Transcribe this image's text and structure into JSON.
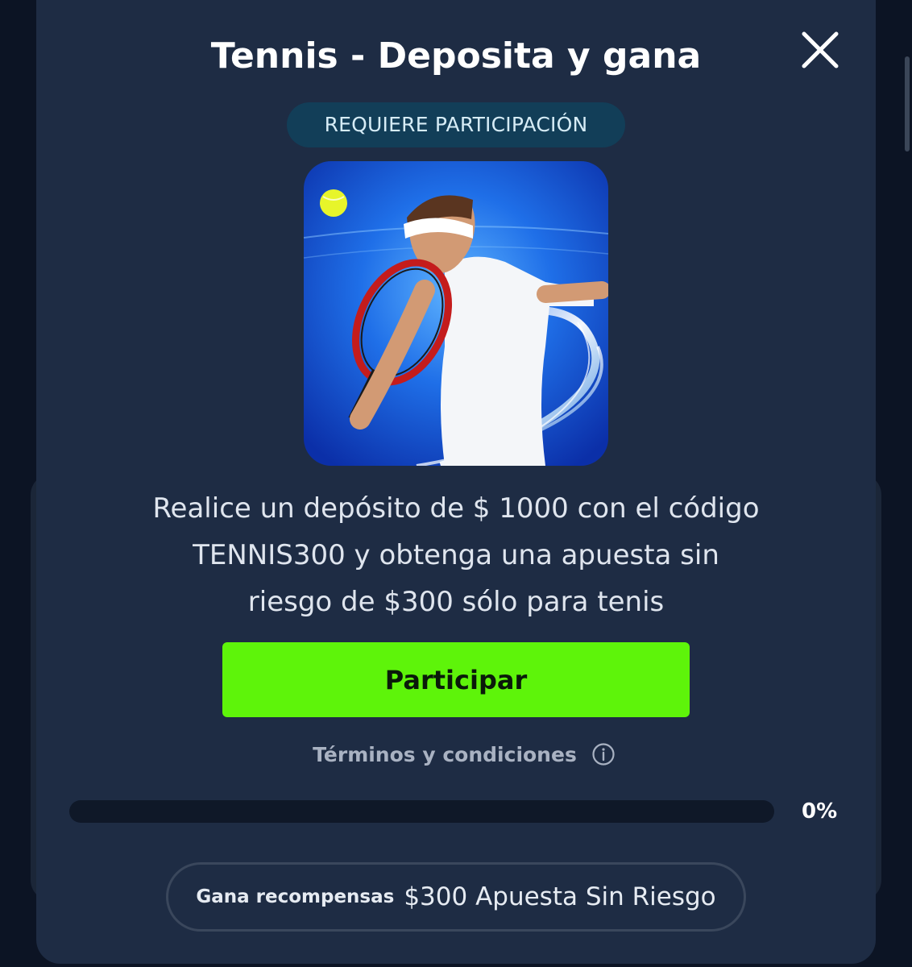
{
  "modal": {
    "title": "Tennis - Deposita y gana",
    "badge": "REQUIERE PARTICIPACIÓN",
    "description_lines": [
      "Realice un depósito de $ 1000 con el código",
      "TENNIS300 y obtenga una apuesta sin",
      "riesgo de $300 sólo para tenis"
    ],
    "cta_label": "Participar",
    "terms_label": "Términos y condiciones",
    "progress": {
      "value": 0,
      "label": "0%"
    },
    "reward": {
      "label": "Gana recompensas",
      "value": "$300 Apuesta Sin Riesgo"
    }
  },
  "icons": {
    "close": "close-icon",
    "info": "info-icon",
    "promo_image": "tennis-player-image"
  },
  "colors": {
    "modal_bg": "#1e2c44",
    "page_bg": "#0c1424",
    "accent": "#5ef40a",
    "badge_bg": "#123e58"
  }
}
